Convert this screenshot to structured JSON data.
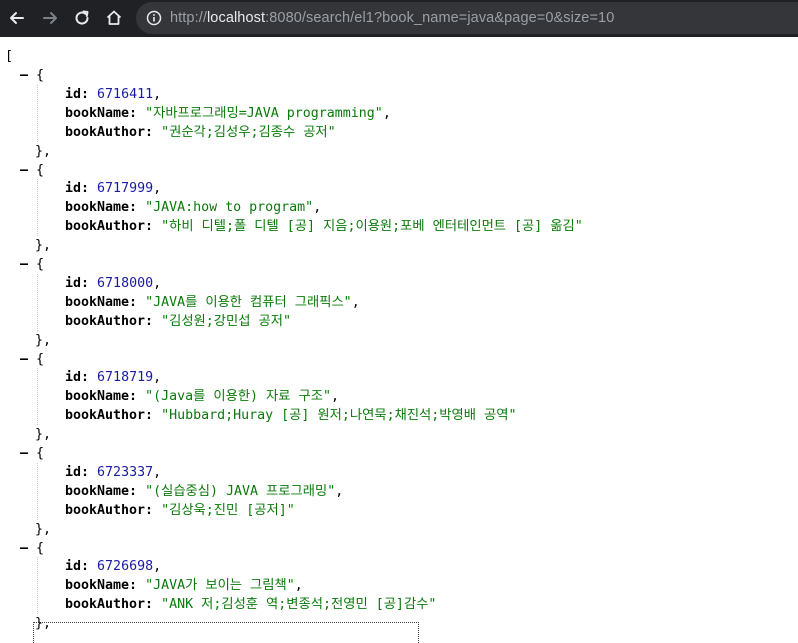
{
  "browser": {
    "url_scheme": "http://",
    "url_host": "localhost",
    "url_path": ":8080/search/el1?book_name=java&page=0&size=10",
    "back_icon": "arrow-left-icon",
    "forward_icon": "arrow-right-icon",
    "reload_icon": "reload-icon",
    "home_icon": "home-icon",
    "info_icon": "info-circle-icon"
  },
  "json": {
    "open_bracket": "[",
    "collapse_symbol": "–",
    "open_brace": "{",
    "close_brace": "},",
    "labels": {
      "id": "id:",
      "bookName": "bookName:",
      "bookAuthor": "bookAuthor:"
    },
    "colors": {
      "number": "#1a1aa6",
      "string": "#0b7a0b"
    },
    "records": [
      {
        "id": "6716411",
        "bookName": "\"자바프로그래밍=JAVA programming\"",
        "bookAuthor": "\"권순각;김성우;김종수 공저\""
      },
      {
        "id": "6717999",
        "bookName": "\"JAVA:how to program\"",
        "bookAuthor": "\"하비 디텔;폴 디텔 [공] 지음;이용원;포베 엔터테인먼트 [공] 옮김\""
      },
      {
        "id": "6718000",
        "bookName": "\"JAVA를 이용한 컴퓨터 그래픽스\"",
        "bookAuthor": "\"김성원;강민섭 공저\""
      },
      {
        "id": "6718719",
        "bookName": "\"(Java를 이용한) 자료 구조\"",
        "bookAuthor": "\"Hubbard;Huray [공] 원저;나연묵;채진석;박영배 공역\""
      },
      {
        "id": "6723337",
        "bookName": "\"(실습중심) JAVA 프로그래밍\"",
        "bookAuthor": "\"김상욱;진민 [공저]\""
      },
      {
        "id": "6726698",
        "bookName": "\"JAVA가 보이는 그림책\"",
        "bookAuthor": "\"ANK 저;김성훈 역;변종석;전영민 [공]감수\""
      }
    ]
  }
}
